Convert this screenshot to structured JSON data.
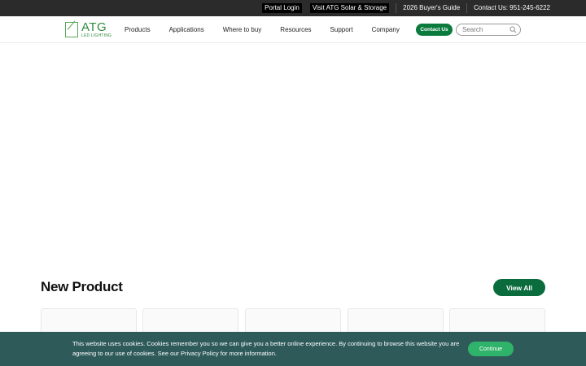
{
  "topbar": {
    "portal_login": "Portal Login",
    "visit_solar": "Visit ATG Solar & Storage",
    "buyers_guide": "2026 Buyer's Guide",
    "contact": "Contact Us: 951-245-6222"
  },
  "logo": {
    "name": "ATG",
    "sub": "LED LIGHTING"
  },
  "nav": {
    "items": [
      "Products",
      "Applications",
      "Where to buy",
      "Resources",
      "Support",
      "Company"
    ]
  },
  "header": {
    "contact_button": "Contact Us",
    "search_placeholder": "Search"
  },
  "section": {
    "title": "New Product",
    "view_all": "View All"
  },
  "cookie": {
    "message": "This website uses cookies. Cookies remember you so we can give you a better online experience. By continuing to browse this website you are agreeing to our use of cookies. See our Privacy Policy for more information.",
    "continue": "Continue"
  },
  "colors": {
    "brand_green": "#0a7a3d",
    "topbar_bg": "#2b2b2b",
    "cookie_bg": "#2f5a5a",
    "continue_green": "#2fb36a"
  }
}
